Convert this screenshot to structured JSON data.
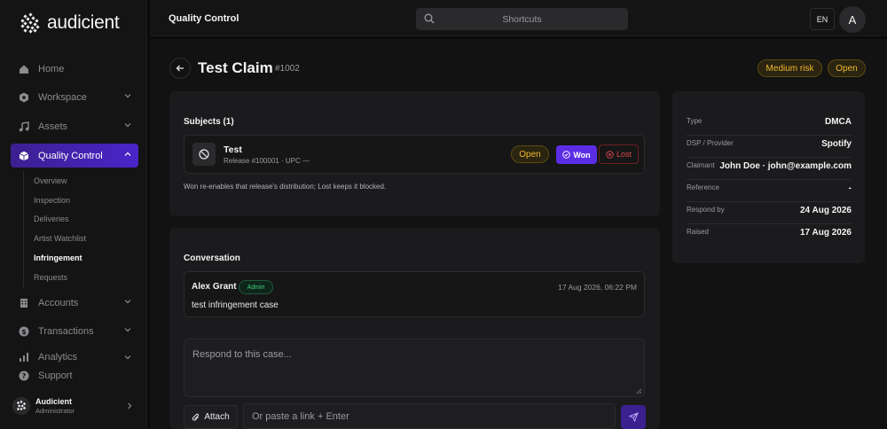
{
  "brand": {
    "name": "audicient"
  },
  "sidebar": {
    "items": [
      {
        "label": "Home",
        "icon": "home-icon"
      },
      {
        "label": "Workspace",
        "icon": "hexagon-icon"
      },
      {
        "label": "Assets",
        "icon": "music-icon"
      },
      {
        "label": "Quality Control",
        "icon": "box-icon",
        "active": true
      },
      {
        "label": "Accounts",
        "icon": "building-icon"
      },
      {
        "label": "Transactions",
        "icon": "dollar-icon"
      },
      {
        "label": "Analytics",
        "icon": "chart-icon"
      },
      {
        "label": "Support",
        "icon": "help-icon"
      }
    ],
    "sub_items": [
      {
        "label": "Overview"
      },
      {
        "label": "Inspection"
      },
      {
        "label": "Deliveries"
      },
      {
        "label": "Artist Watchlist"
      },
      {
        "label": "Infringement",
        "active": true
      },
      {
        "label": "Requests"
      }
    ],
    "user": {
      "name": "Audicient",
      "role": "Administrator"
    }
  },
  "topbar": {
    "title": "Quality Control",
    "search_label": "Shortcuts",
    "lang": "EN",
    "avatar_initial": "A"
  },
  "claim": {
    "title": "Test Claim",
    "number": "#1002",
    "risk": "Medium risk",
    "status": "Open"
  },
  "subjects": {
    "title": "Subjects (1)",
    "item": {
      "name": "Test",
      "meta": "Release #100001 · UPC —",
      "status": "Open",
      "won_label": "Won",
      "lost_label": "Lost"
    },
    "hint": "Won re-enables that release's distribution; Lost keeps it blocked."
  },
  "conversation": {
    "title": "Conversation",
    "message": {
      "author": "Alex Grant",
      "badge": "Admin",
      "time": "17 Aug 2026, 06:22 PM",
      "text": "test infringement case"
    },
    "reply_placeholder": "Respond to this case...",
    "attach_label": "Attach",
    "link_placeholder": "Or paste a link + Enter"
  },
  "details": [
    {
      "label": "Type",
      "value": "DMCA"
    },
    {
      "label": "DSP / Provider",
      "value": "Spotify"
    },
    {
      "label": "Claimant",
      "value": "John Doe · john@example.com"
    },
    {
      "label": "Reference",
      "value": "-"
    },
    {
      "label": "Respond by",
      "value": "24 Aug 2026"
    },
    {
      "label": "Raised",
      "value": "17 Aug 2026"
    }
  ],
  "colors": {
    "accent": "#5b2ee6",
    "warning": "#f5b82e",
    "danger": "#e0474f",
    "success": "#3ad17e"
  }
}
